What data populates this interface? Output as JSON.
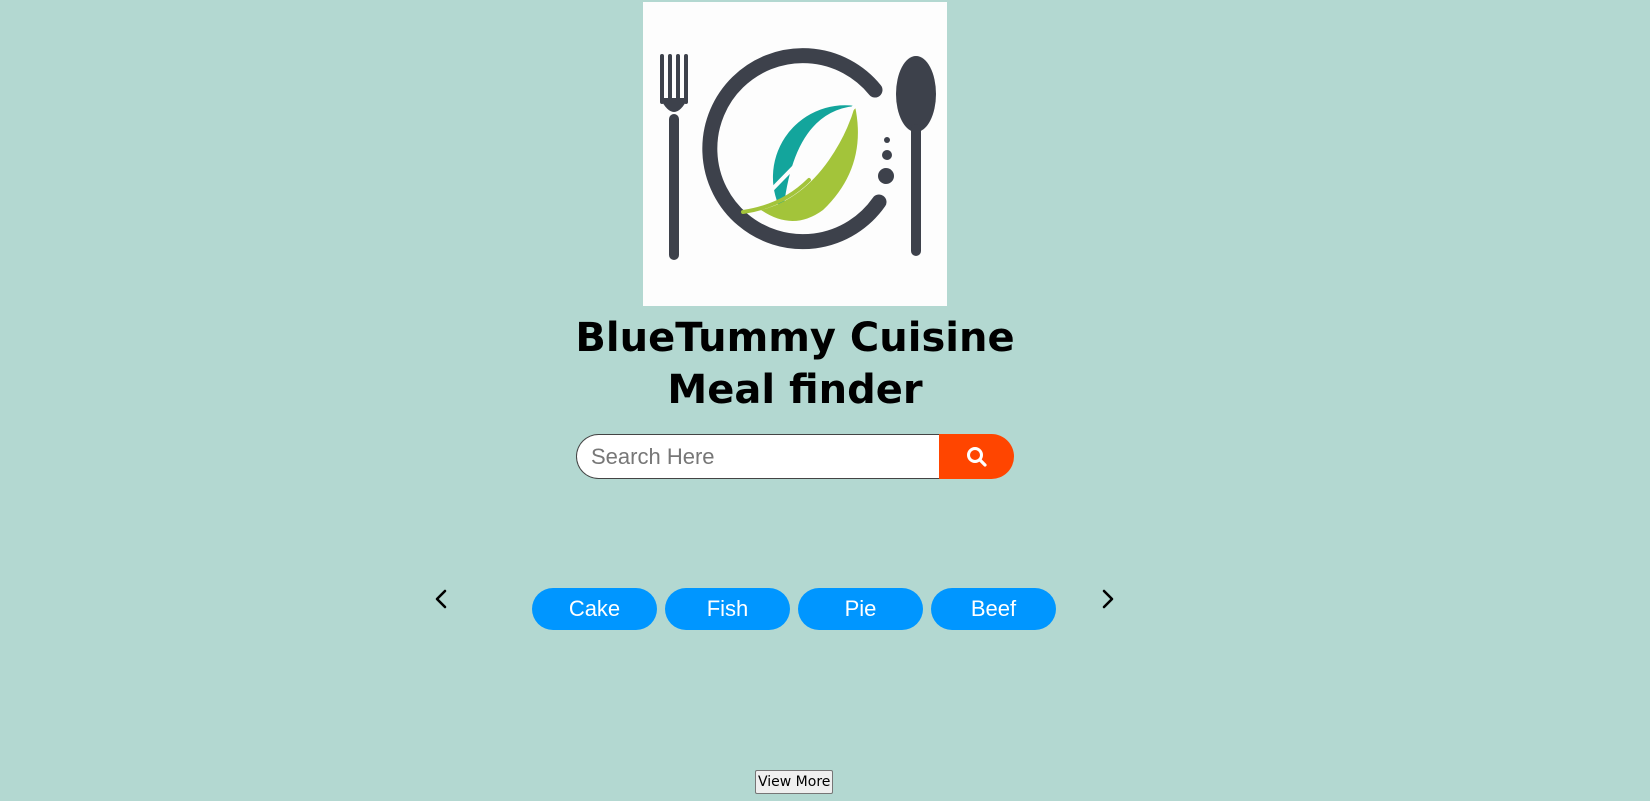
{
  "header": {
    "logo_icon": "plate-fork-spoon-leaf-logo",
    "title_line1": "BlueTummy Cuisine",
    "title_line2": "Meal finder"
  },
  "search": {
    "placeholder": "Search Here",
    "value": "",
    "button_icon": "search-icon"
  },
  "carousel": {
    "prev_icon": "chevron-left-icon",
    "next_icon": "chevron-right-icon",
    "categories": [
      "Cake",
      "Fish",
      "Pie",
      "Beef"
    ]
  },
  "view_more_label": "View More",
  "colors": {
    "background": "#b3d8d1",
    "search_button": "#ff4500",
    "category_chip": "#0096ff",
    "logo_dark": "#3d414b",
    "logo_teal": "#13a59c",
    "logo_green": "#a3c43a"
  }
}
